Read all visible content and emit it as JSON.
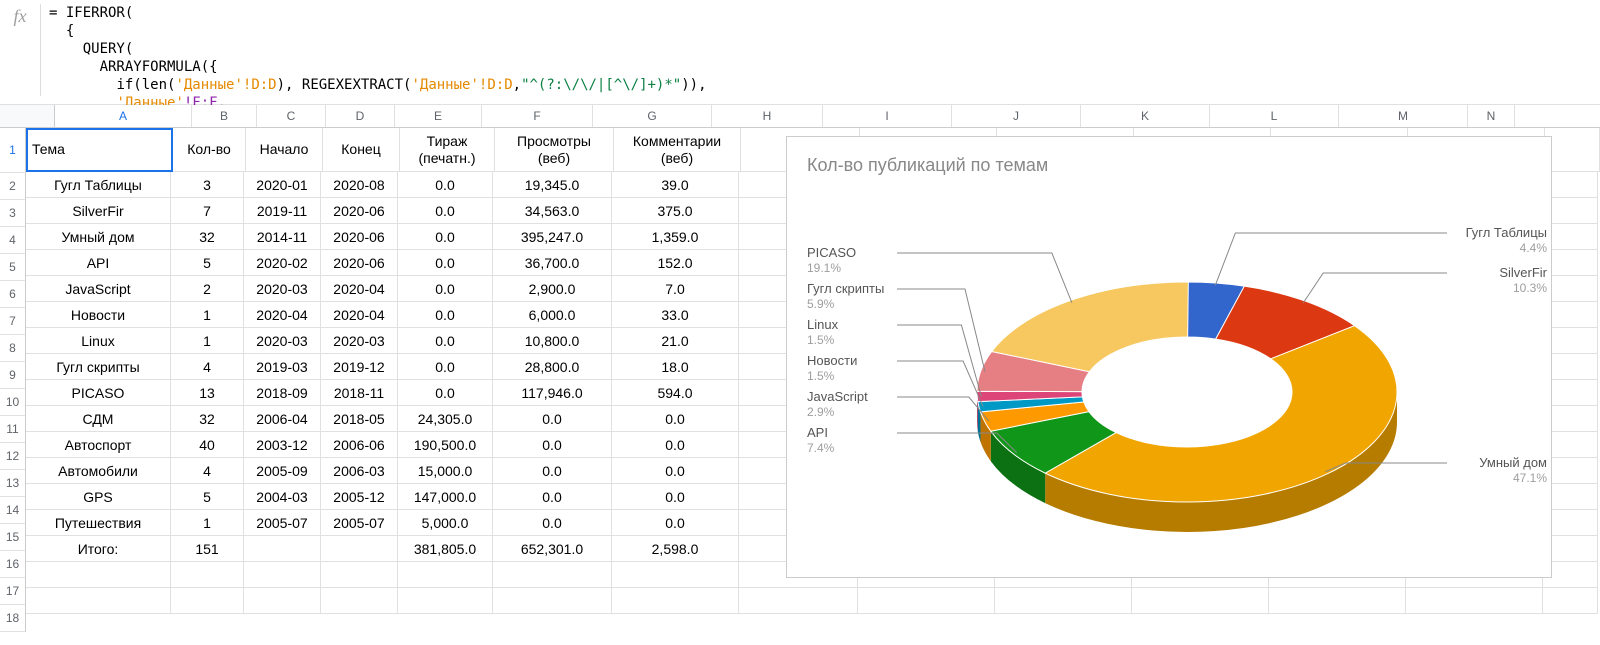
{
  "formula": {
    "lines": [
      "= IFERROR(",
      "  {",
      "    QUERY(",
      "      ARRAYFORMULA({",
      "        if(len('Данные'!D:D), REGEXEXTRACT('Данные'!D:D,\"^(?:\\/\\/|[^\\/]+)*\")),",
      "        'Данные'!F:F,"
    ]
  },
  "columns": {
    "letters": [
      "A",
      "B",
      "C",
      "D",
      "E",
      "F",
      "G",
      "H",
      "I",
      "J",
      "K",
      "L",
      "M",
      "N"
    ],
    "widths": [
      136,
      64,
      68,
      68,
      86,
      110,
      118,
      110,
      128,
      128,
      128,
      128,
      128,
      46
    ]
  },
  "headers": [
    "Тема",
    "Кол-во",
    "Начало",
    "Конец",
    "Тираж (печатн.)",
    "Просмотры (веб)",
    "Комментарии (веб)"
  ],
  "rows": [
    {
      "a": "Гугл Таблицы",
      "b": "3",
      "c": "2020-01",
      "d": "2020-08",
      "e": "0.0",
      "f": "19,345.0",
      "g": "39.0"
    },
    {
      "a": "SilverFir",
      "b": "7",
      "c": "2019-11",
      "d": "2020-06",
      "e": "0.0",
      "f": "34,563.0",
      "g": "375.0"
    },
    {
      "a": "Умный дом",
      "b": "32",
      "c": "2014-11",
      "d": "2020-06",
      "e": "0.0",
      "f": "395,247.0",
      "g": "1,359.0"
    },
    {
      "a": "API",
      "b": "5",
      "c": "2020-02",
      "d": "2020-06",
      "e": "0.0",
      "f": "36,700.0",
      "g": "152.0"
    },
    {
      "a": "JavaScript",
      "b": "2",
      "c": "2020-03",
      "d": "2020-04",
      "e": "0.0",
      "f": "2,900.0",
      "g": "7.0"
    },
    {
      "a": "Новости",
      "b": "1",
      "c": "2020-04",
      "d": "2020-04",
      "e": "0.0",
      "f": "6,000.0",
      "g": "33.0"
    },
    {
      "a": "Linux",
      "b": "1",
      "c": "2020-03",
      "d": "2020-03",
      "e": "0.0",
      "f": "10,800.0",
      "g": "21.0"
    },
    {
      "a": "Гугл скрипты",
      "b": "4",
      "c": "2019-03",
      "d": "2019-12",
      "e": "0.0",
      "f": "28,800.0",
      "g": "18.0"
    },
    {
      "a": "PICASO",
      "b": "13",
      "c": "2018-09",
      "d": "2018-11",
      "e": "0.0",
      "f": "117,946.0",
      "g": "594.0"
    },
    {
      "a": "СДМ",
      "b": "32",
      "c": "2006-04",
      "d": "2018-05",
      "e": "24,305.0",
      "f": "0.0",
      "g": "0.0"
    },
    {
      "a": "Автоспорт",
      "b": "40",
      "c": "2003-12",
      "d": "2006-06",
      "e": "190,500.0",
      "f": "0.0",
      "g": "0.0"
    },
    {
      "a": "Автомобили",
      "b": "4",
      "c": "2005-09",
      "d": "2006-03",
      "e": "15,000.0",
      "f": "0.0",
      "g": "0.0"
    },
    {
      "a": "GPS",
      "b": "5",
      "c": "2004-03",
      "d": "2005-12",
      "e": "147,000.0",
      "f": "0.0",
      "g": "0.0"
    },
    {
      "a": "Путешествия",
      "b": "1",
      "c": "2005-07",
      "d": "2005-07",
      "e": "5,000.0",
      "f": "0.0",
      "g": "0.0"
    },
    {
      "a": "Итого:",
      "b": "151",
      "c": "",
      "d": "",
      "e": "381,805.0",
      "f": "652,301.0",
      "g": "2,598.0"
    }
  ],
  "row_count_visible": 18,
  "active_cell": "A1",
  "chart_data": {
    "type": "pie",
    "title": "Кол-во публикаций по темам",
    "series": [
      {
        "name": "Гугл Таблицы",
        "pct": 4.4,
        "color": "#3366cc"
      },
      {
        "name": "SilverFir",
        "pct": 10.3,
        "color": "#dc3912"
      },
      {
        "name": "Умный дом",
        "pct": 47.1,
        "color": "#f1a500"
      },
      {
        "name": "API",
        "pct": 7.4,
        "color": "#109618"
      },
      {
        "name": "JavaScript",
        "pct": 2.9,
        "color": "#ff9900"
      },
      {
        "name": "Новости",
        "pct": 1.5,
        "color": "#0099c6"
      },
      {
        "name": "Linux",
        "pct": 1.5,
        "color": "#dd4477"
      },
      {
        "name": "Гугл скрипты",
        "pct": 5.9,
        "color": "#e67f83"
      },
      {
        "name": "PICASO",
        "pct": 19.1,
        "color": "#f6c85f"
      }
    ],
    "labels_left": [
      {
        "name": "PICASO",
        "pct": "19.1%"
      },
      {
        "name": "Гугл скрипты",
        "pct": "5.9%"
      },
      {
        "name": "Linux",
        "pct": "1.5%"
      },
      {
        "name": "Новости",
        "pct": "1.5%"
      },
      {
        "name": "JavaScript",
        "pct": "2.9%"
      },
      {
        "name": "API",
        "pct": "7.4%"
      }
    ],
    "labels_right": [
      {
        "name": "Гугл Таблицы",
        "pct": "4.4%"
      },
      {
        "name": "SilverFir",
        "pct": "10.3%"
      },
      {
        "name": "Умный дом",
        "pct": "47.1%"
      }
    ]
  }
}
